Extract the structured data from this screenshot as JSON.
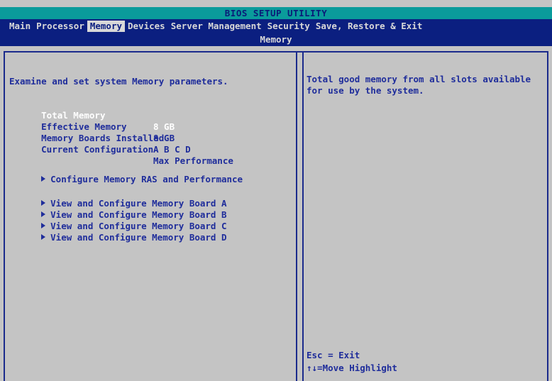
{
  "title": "BIOS SETUP UTILITY",
  "menu": {
    "tabs": [
      {
        "label": "Main"
      },
      {
        "label": "Processor"
      },
      {
        "label": "Memory"
      },
      {
        "label": "Devices"
      },
      {
        "label": "Server Management"
      },
      {
        "label": "Security"
      },
      {
        "label": "Save, Restore & Exit"
      }
    ],
    "active": "Memory",
    "subtitle": "Memory"
  },
  "left": {
    "description": "Examine and set system Memory parameters.",
    "fields": [
      {
        "label": "Total Memory",
        "value": "8 GB"
      },
      {
        "label": "Effective Memory",
        "value": "8 GB"
      },
      {
        "label": "Memory Boards Installed",
        "value": "A B C D"
      },
      {
        "label": "Current Configuration",
        "value": "Max Performance"
      }
    ],
    "submenus": [
      {
        "label": "Configure Memory RAS and Performance"
      },
      {
        "label": "View and Configure Memory Board A"
      },
      {
        "label": "View and Configure Memory Board B"
      },
      {
        "label": "View and Configure Memory Board C"
      },
      {
        "label": "View and Configure Memory Board D"
      }
    ]
  },
  "right": {
    "help_lines": [
      "Total good memory from all slots available",
      "for use by the system."
    ],
    "keys": [
      "Esc = Exit",
      "↑↓=Move Highlight"
    ]
  },
  "colors": {
    "background": "#c4c4c4",
    "title_bar": "#0a9b9b",
    "menu_bar": "#0b1f80",
    "text_blue": "#1f2d9b",
    "text_highlight": "#ffffff"
  }
}
